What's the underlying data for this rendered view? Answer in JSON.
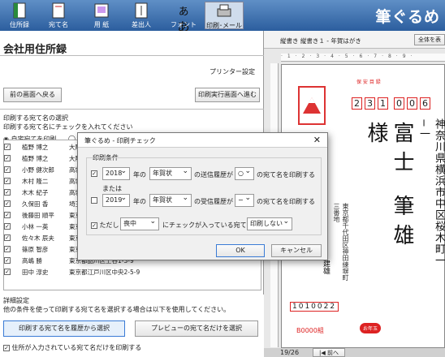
{
  "toolbar": {
    "items": [
      {
        "label": "住所録"
      },
      {
        "label": "宛て名"
      },
      {
        "label": "用 紙"
      },
      {
        "label": "差出人"
      },
      {
        "label": "フォント"
      },
      {
        "label": "印刷･メール"
      }
    ],
    "logo": "筆ぐるめ"
  },
  "left": {
    "title": "会社用住所録",
    "printer_settings": "プリンター設定",
    "back_button": "前の画面へ戻る",
    "next_button": "印刷実行画面へ進む",
    "section_title": "印刷する宛て名の選択",
    "instruction": "印刷する宛て名にチェックを入れてください",
    "radio1": "自宅宛てを印刷",
    "col_print": "印刷",
    "col_name": "氏名",
    "rows": [
      {
        "name": "植野 博之",
        "addr": "大阪"
      },
      {
        "name": "植野 博之",
        "addr": "大阪"
      },
      {
        "name": "小野 健次郎",
        "addr": "高城"
      },
      {
        "name": "木村 隆二",
        "addr": "高城"
      },
      {
        "name": "木木 紀子",
        "addr": "高城"
      },
      {
        "name": "久保田 香",
        "addr": "埼玉"
      },
      {
        "name": "後藤田 順平",
        "addr": "東京"
      },
      {
        "name": "小林 一英",
        "addr": "東京"
      },
      {
        "name": "佐々木 辰夫",
        "addr": "東京"
      },
      {
        "name": "篠原 智彦",
        "addr": "東京都足立区八潮1-80-12"
      },
      {
        "name": "高嶋 勝",
        "addr": "東京都品川区上谷1-3-9"
      },
      {
        "name": "田中 淳史",
        "addr": "東京都江戸川区中央2-5-9"
      }
    ],
    "detail_title": "詳細設定",
    "detail_text": "他の条件を使って印刷する宛て名を選択する場合は以下を使用してください。",
    "history_button": "印刷する宛て名を履歴から選択",
    "preview_button": "プレビューの宛て名だけを選択",
    "only_addr_check": "住所が入力されている宛て名だけを印刷する"
  },
  "right": {
    "toolbar_text": "縦書き 縦書き１ - 年賀はがき",
    "view_button": "全体を表",
    "page": "19/26",
    "prev_button": "前へ"
  },
  "card": {
    "zip": [
      "2",
      "3",
      "1",
      "0",
      "0",
      "6"
    ],
    "small_zip": "1010022",
    "header": "保 安 目 録",
    "recipient_addr": "神奈川県横浜市中区桜木町一−一",
    "recipient_name": "富士 筆雄 様",
    "sender_addr": "東京都千代田区神田練塀町三番地",
    "sender_name": "建雄",
    "lottery": "B0000組",
    "label": "お年玉"
  },
  "dialog": {
    "title": "筆ぐるめ - 印刷チェック",
    "group_title": "印刷条件",
    "row1": {
      "year": "2018",
      "year_suffix": "年の",
      "type": "年賀状",
      "mid": "の送信履歴が",
      "mark": "○",
      "end": "の宛て名を印刷する"
    },
    "or": "または",
    "row2": {
      "year": "2019",
      "year_suffix": "年の",
      "type": "年賀状",
      "mid": "の受信履歴が",
      "mark": "−",
      "end": "の宛て名を印刷する"
    },
    "row3": {
      "prefix": "ただし",
      "type": "喪中",
      "mid": "にチェックが入っている宛て名は",
      "action": "印刷しない"
    },
    "ok": "OK",
    "cancel": "キャンセル"
  }
}
